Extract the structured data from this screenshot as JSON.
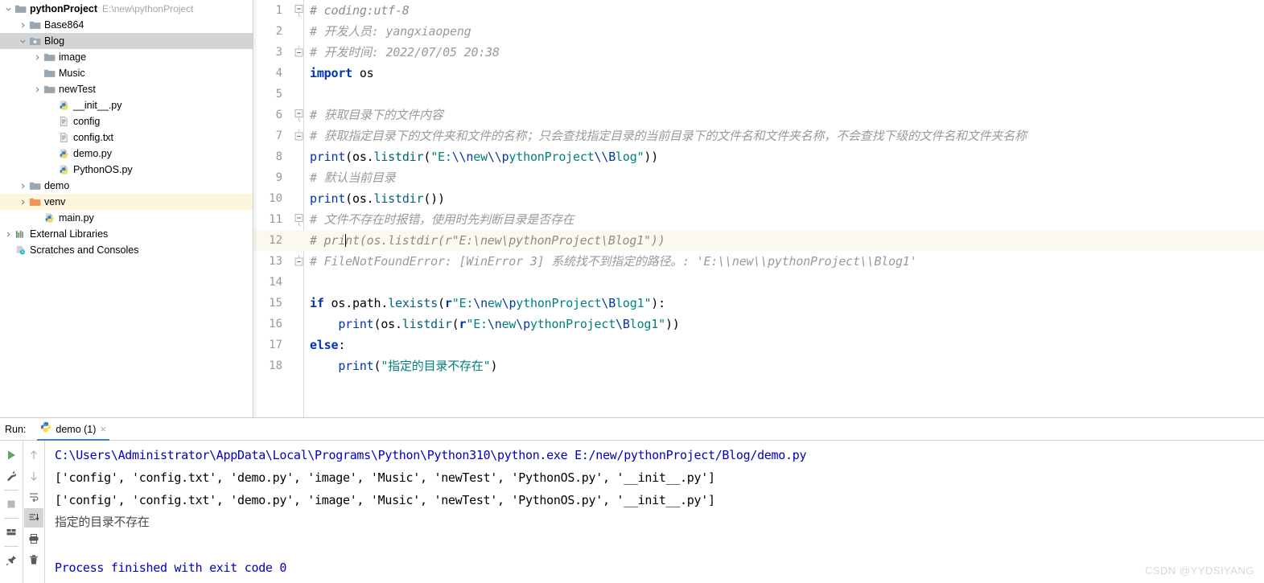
{
  "project_tree": {
    "rows": [
      {
        "indent": 0,
        "arrow": "down",
        "icon": "folder-icon",
        "label": "pythonProject",
        "bold": true,
        "path": "E:\\new\\pythonProject",
        "state": "none"
      },
      {
        "indent": 1,
        "arrow": "right",
        "icon": "folder-icon",
        "label": "Base864",
        "bold": false,
        "path": "",
        "state": "none"
      },
      {
        "indent": 1,
        "arrow": "down",
        "icon": "folder-source-icon",
        "label": "Blog",
        "bold": false,
        "path": "",
        "state": "selected"
      },
      {
        "indent": 2,
        "arrow": "right",
        "icon": "folder-icon",
        "label": "image",
        "bold": false,
        "path": "",
        "state": "none"
      },
      {
        "indent": 2,
        "arrow": "none",
        "icon": "folder-icon",
        "label": "Music",
        "bold": false,
        "path": "",
        "state": "none"
      },
      {
        "indent": 2,
        "arrow": "right",
        "icon": "folder-icon",
        "label": "newTest",
        "bold": false,
        "path": "",
        "state": "none"
      },
      {
        "indent": 3,
        "arrow": "none",
        "icon": "python-file-icon",
        "label": "__init__.py",
        "bold": false,
        "path": "",
        "state": "none"
      },
      {
        "indent": 3,
        "arrow": "none",
        "icon": "text-file-icon",
        "label": "config",
        "bold": false,
        "path": "",
        "state": "none"
      },
      {
        "indent": 3,
        "arrow": "none",
        "icon": "text-file-icon",
        "label": "config.txt",
        "bold": false,
        "path": "",
        "state": "none"
      },
      {
        "indent": 3,
        "arrow": "none",
        "icon": "python-file-icon",
        "label": "demo.py",
        "bold": false,
        "path": "",
        "state": "none"
      },
      {
        "indent": 3,
        "arrow": "none",
        "icon": "python-file-icon",
        "label": "PythonOS.py",
        "bold": false,
        "path": "",
        "state": "none"
      },
      {
        "indent": 1,
        "arrow": "right",
        "icon": "folder-icon",
        "label": "demo",
        "bold": false,
        "path": "",
        "state": "none"
      },
      {
        "indent": 1,
        "arrow": "right",
        "icon": "folder-venv-icon",
        "label": "venv",
        "bold": false,
        "path": "",
        "state": "highlight"
      },
      {
        "indent": 2,
        "arrow": "none",
        "icon": "python-file-icon",
        "label": "main.py",
        "bold": false,
        "path": "",
        "state": "none"
      },
      {
        "indent": 0,
        "arrow": "right",
        "icon": "external-libraries-icon",
        "label": "External Libraries",
        "bold": false,
        "path": "",
        "state": "none"
      },
      {
        "indent": 0,
        "arrow": "none",
        "icon": "scratches-icon",
        "label": "Scratches and Consoles",
        "bold": false,
        "path": "",
        "state": "none"
      }
    ]
  },
  "editor": {
    "highlighted_line": 12,
    "caret_line": 12,
    "lines": [
      {
        "n": 1,
        "fold": "start",
        "text": "# coding:utf-8"
      },
      {
        "n": 2,
        "fold": "none",
        "text": "# 开发人员: yangxiaopeng"
      },
      {
        "n": 3,
        "fold": "end",
        "text": "# 开发时间: 2022/07/05 20:38"
      },
      {
        "n": 4,
        "fold": "none",
        "text": "import os"
      },
      {
        "n": 5,
        "fold": "none",
        "text": ""
      },
      {
        "n": 6,
        "fold": "start",
        "text": "# 获取目录下的文件内容"
      },
      {
        "n": 7,
        "fold": "end",
        "text": "# 获取指定目录下的文件夹和文件的名称；只会查找指定目录的当前目录下的文件名和文件夹名称，不会查找下级的文件名和文件夹名称"
      },
      {
        "n": 8,
        "fold": "none",
        "text": "print(os.listdir(\"E:\\\\new\\\\pythonProject\\\\Blog\"))"
      },
      {
        "n": 9,
        "fold": "none",
        "text": "# 默认当前目录"
      },
      {
        "n": 10,
        "fold": "none",
        "text": "print(os.listdir())"
      },
      {
        "n": 11,
        "fold": "start",
        "text": "# 文件不存在时报错，使用时先判断目录是否存在"
      },
      {
        "n": 12,
        "fold": "none",
        "text": "# print(os.listdir(r\"E:\\new\\pythonProject\\Blog1\"))"
      },
      {
        "n": 13,
        "fold": "end",
        "text": "# FileNotFoundError: [WinError 3] 系统找不到指定的路径。: 'E:\\\\new\\\\pythonProject\\\\Blog1'"
      },
      {
        "n": 14,
        "fold": "none",
        "text": ""
      },
      {
        "n": 15,
        "fold": "none",
        "text": "if os.path.lexists(r\"E:\\new\\pythonProject\\Blog1\"):"
      },
      {
        "n": 16,
        "fold": "none",
        "text": "    print(os.listdir(r\"E:\\new\\pythonProject\\Blog1\"))"
      },
      {
        "n": 17,
        "fold": "none",
        "text": "else:"
      },
      {
        "n": 18,
        "fold": "none",
        "text": "    print(\"指定的目录不存在\")"
      }
    ]
  },
  "run_panel": {
    "run_label": "Run:",
    "tab_name": "demo (1)",
    "tab_close": "×",
    "tools_left": [
      {
        "name": "rerun-icon"
      },
      {
        "name": "wrench-icon"
      },
      {
        "name": "stop-icon"
      },
      {
        "name": "layout-icon"
      },
      {
        "name": "pin-icon"
      }
    ],
    "tools_right": [
      {
        "name": "arrow-up-icon"
      },
      {
        "name": "arrow-down-icon"
      },
      {
        "name": "soft-wrap-icon"
      },
      {
        "name": "scroll-to-end-icon",
        "active": true
      },
      {
        "name": "print-icon"
      },
      {
        "name": "trash-icon"
      }
    ],
    "console_lines": [
      {
        "color": "blue",
        "text": "C:\\Users\\Administrator\\AppData\\Local\\Programs\\Python\\Python310\\python.exe E:/new/pythonProject/Blog/demo.py"
      },
      {
        "color": "black",
        "text": "['config', 'config.txt', 'demo.py', 'image', 'Music', 'newTest', 'PythonOS.py', '__init__.py']"
      },
      {
        "color": "black",
        "text": "['config', 'config.txt', 'demo.py', 'image', 'Music', 'newTest', 'PythonOS.py', '__init__.py']"
      },
      {
        "color": "grey",
        "text": "指定的目录不存在"
      },
      {
        "color": "black",
        "text": ""
      },
      {
        "color": "blue",
        "text": "Process finished with exit code 0"
      }
    ]
  },
  "watermark": "CSDN @YYDSIYANG",
  "colors": {
    "selection_grey": "#d4d4d4",
    "highlight_yellow": "#fdf6dd",
    "line_highlight": "#fbf8ef",
    "tab_underline": "#4083c9",
    "console_blue": "#0000c0",
    "keyword_blue": "#0033b3",
    "string_teal": "#008080",
    "comment_grey": "#8c8c8c"
  }
}
